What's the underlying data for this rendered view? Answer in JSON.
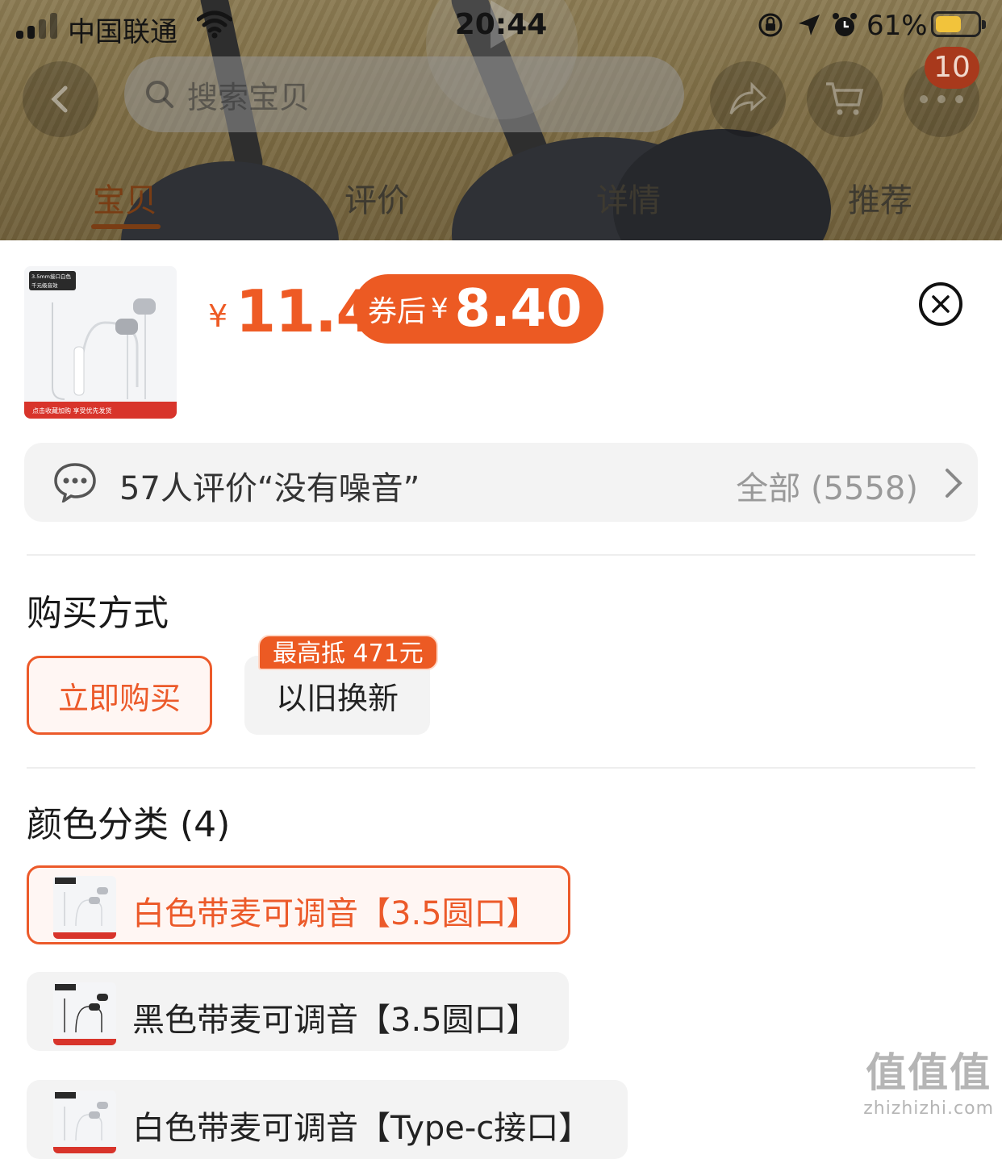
{
  "status_bar": {
    "carrier": "中国联通",
    "time": "20:44",
    "battery_percent": "61%",
    "battery_level": 0.61
  },
  "header": {
    "search_placeholder": "搜索宝贝",
    "cart_badge": "10"
  },
  "tabs": [
    {
      "label": "宝贝",
      "active": true
    },
    {
      "label": "评价",
      "active": false
    },
    {
      "label": "详情",
      "active": false
    },
    {
      "label": "推荐",
      "active": false
    }
  ],
  "sheet": {
    "price_symbol": "¥",
    "price": "11.4",
    "coupon_label": "券后",
    "coupon_symbol": "¥",
    "coupon_price": "8.40",
    "review": {
      "text": "57人评价“没有噪音”",
      "all_label": "全部 (5558)"
    },
    "purchase_section": {
      "title": "购买方式",
      "options": [
        {
          "label": "立即购买",
          "selected": true
        },
        {
          "label": "以旧换新",
          "selected": false,
          "tag": "最高抵 471元"
        }
      ]
    },
    "color_section": {
      "title": "颜色分类 (4)",
      "options": [
        {
          "label": "白色带麦可调音【3.5圆口】",
          "selected": true,
          "earbud_color": "#b9bcc2"
        },
        {
          "label": "黑色带麦可调音【3.5圆口】",
          "selected": false,
          "earbud_color": "#2b2b2b"
        },
        {
          "label": "白色带麦可调音【Type-c接口】",
          "selected": false,
          "earbud_color": "#b9bcc2"
        }
      ]
    }
  },
  "product_image": {
    "tag_top": "3.5mm接口白色",
    "tag_sub": "千元级音效",
    "banner_text": "点击收藏加购  享受优先发货"
  },
  "watermark": {
    "big": "值值值",
    "small": "zhizhizhi.com"
  },
  "colors": {
    "accent": "#ec5a23",
    "selected_bg": "#fff6f3",
    "option_bg": "#f3f3f3"
  }
}
